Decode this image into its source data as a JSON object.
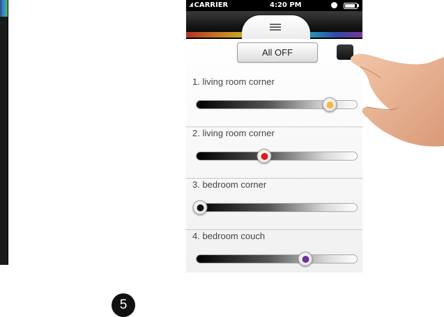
{
  "status_bar": {
    "carrier": "CARRIER",
    "time": "4:20 PM"
  },
  "menu_icon": "hamburger-menu-icon",
  "all_off_label": "All OFF",
  "lights": [
    {
      "label": "1. living room corner",
      "level": 0.83,
      "color": "#f4b942"
    },
    {
      "label": "2. living room corner",
      "level": 0.42,
      "color": "#d61f1f"
    },
    {
      "label": "3. bedroom corner",
      "level": 0.02,
      "color": "#111111"
    },
    {
      "label": "4. bedroom couch",
      "level": 0.68,
      "color": "#6a2fa0"
    }
  ],
  "step_number": "5"
}
